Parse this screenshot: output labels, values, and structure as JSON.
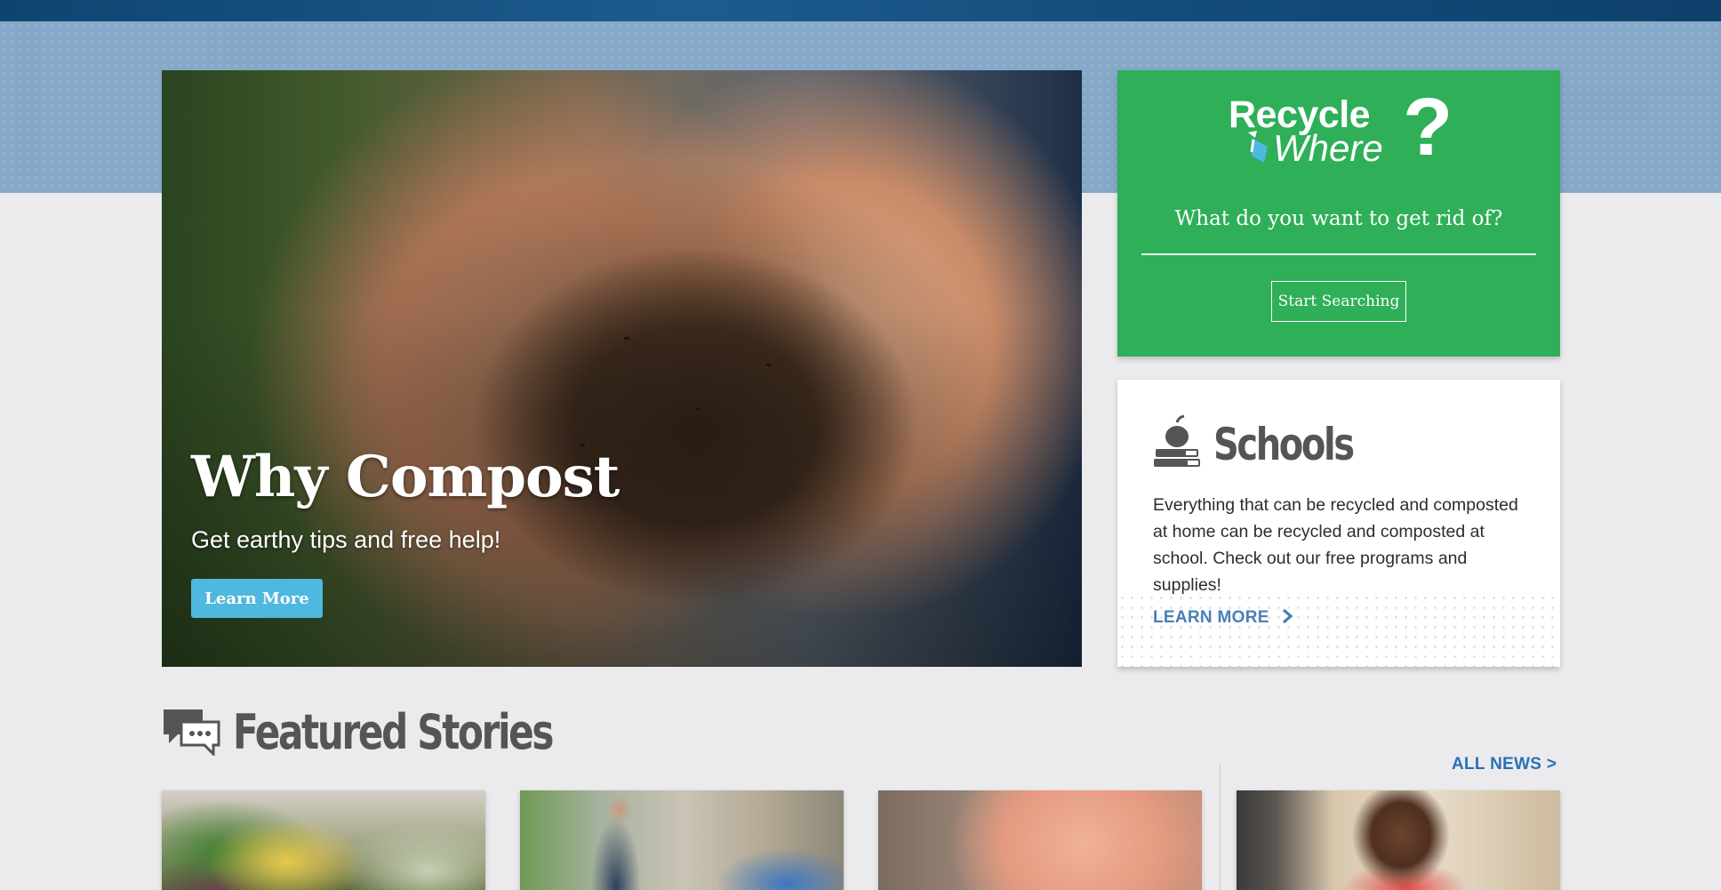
{
  "hero": {
    "title": "Why Compost",
    "subtitle": "Get earthy tips and free help!",
    "button_label": "Learn More"
  },
  "recycle_where": {
    "logo_line1": "Recycle",
    "logo_line2": "Where",
    "logo_mark": "?",
    "prompt": "What do you want to get rid of?",
    "button_label": "Start Searching",
    "accent_color": "#2eaf58"
  },
  "schools": {
    "title": "Schools",
    "icon": "apple-on-books-icon",
    "text": "Everything that can be recycled and composted at home can be recycled and composted at school. Check out our free programs and supplies!",
    "link_label": "LEARN MORE",
    "link_color": "#4a7fb5"
  },
  "featured": {
    "title": "Featured Stories",
    "icon": "chat-bubbles-icon",
    "all_news_label": "ALL NEWS >",
    "stories": [
      {
        "image": "vegetable-scraps-photo"
      },
      {
        "image": "man-with-recycling-bin-photo"
      },
      {
        "image": "girl-with-fork-photo"
      },
      {
        "image": "smiling-woman-photo"
      }
    ]
  }
}
